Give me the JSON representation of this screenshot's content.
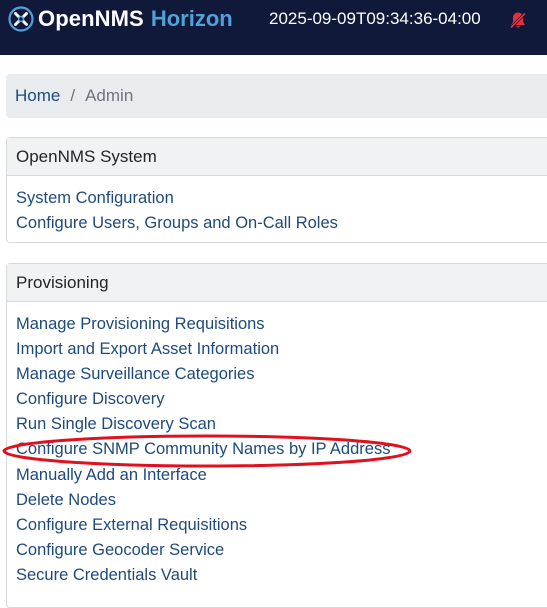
{
  "header": {
    "brand_main": "OpenNMS",
    "brand_sub": "Horizon",
    "clock": "2025-09-09T09:34:36-04:00",
    "icons": [
      "opennms-logo-icon",
      "notifications-off-icon"
    ],
    "colors": {
      "bar": "#11193a",
      "brand_sub": "#4fa3d8",
      "alert": "#e0323c"
    }
  },
  "breadcrumb": {
    "home": "Home",
    "separator": "/",
    "current": "Admin"
  },
  "system": {
    "title": "OpenNMS System",
    "links": [
      "System Configuration",
      "Configure Users, Groups and On-Call Roles"
    ]
  },
  "provisioning": {
    "title": "Provisioning",
    "links": [
      "Manage Provisioning Requisitions",
      "Import and Export Asset Information",
      "Manage Surveillance Categories",
      "Configure Discovery",
      "Run Single Discovery Scan",
      "Configure SNMP Community Names by IP Address",
      "Manually Add an Interface",
      "Delete Nodes",
      "Configure External Requisitions",
      "Configure Geocoder Service",
      "Secure Credentials Vault"
    ]
  },
  "annotation": {
    "color": "#e0101e",
    "highlighted": "Configure SNMP Community Names by IP Address"
  }
}
